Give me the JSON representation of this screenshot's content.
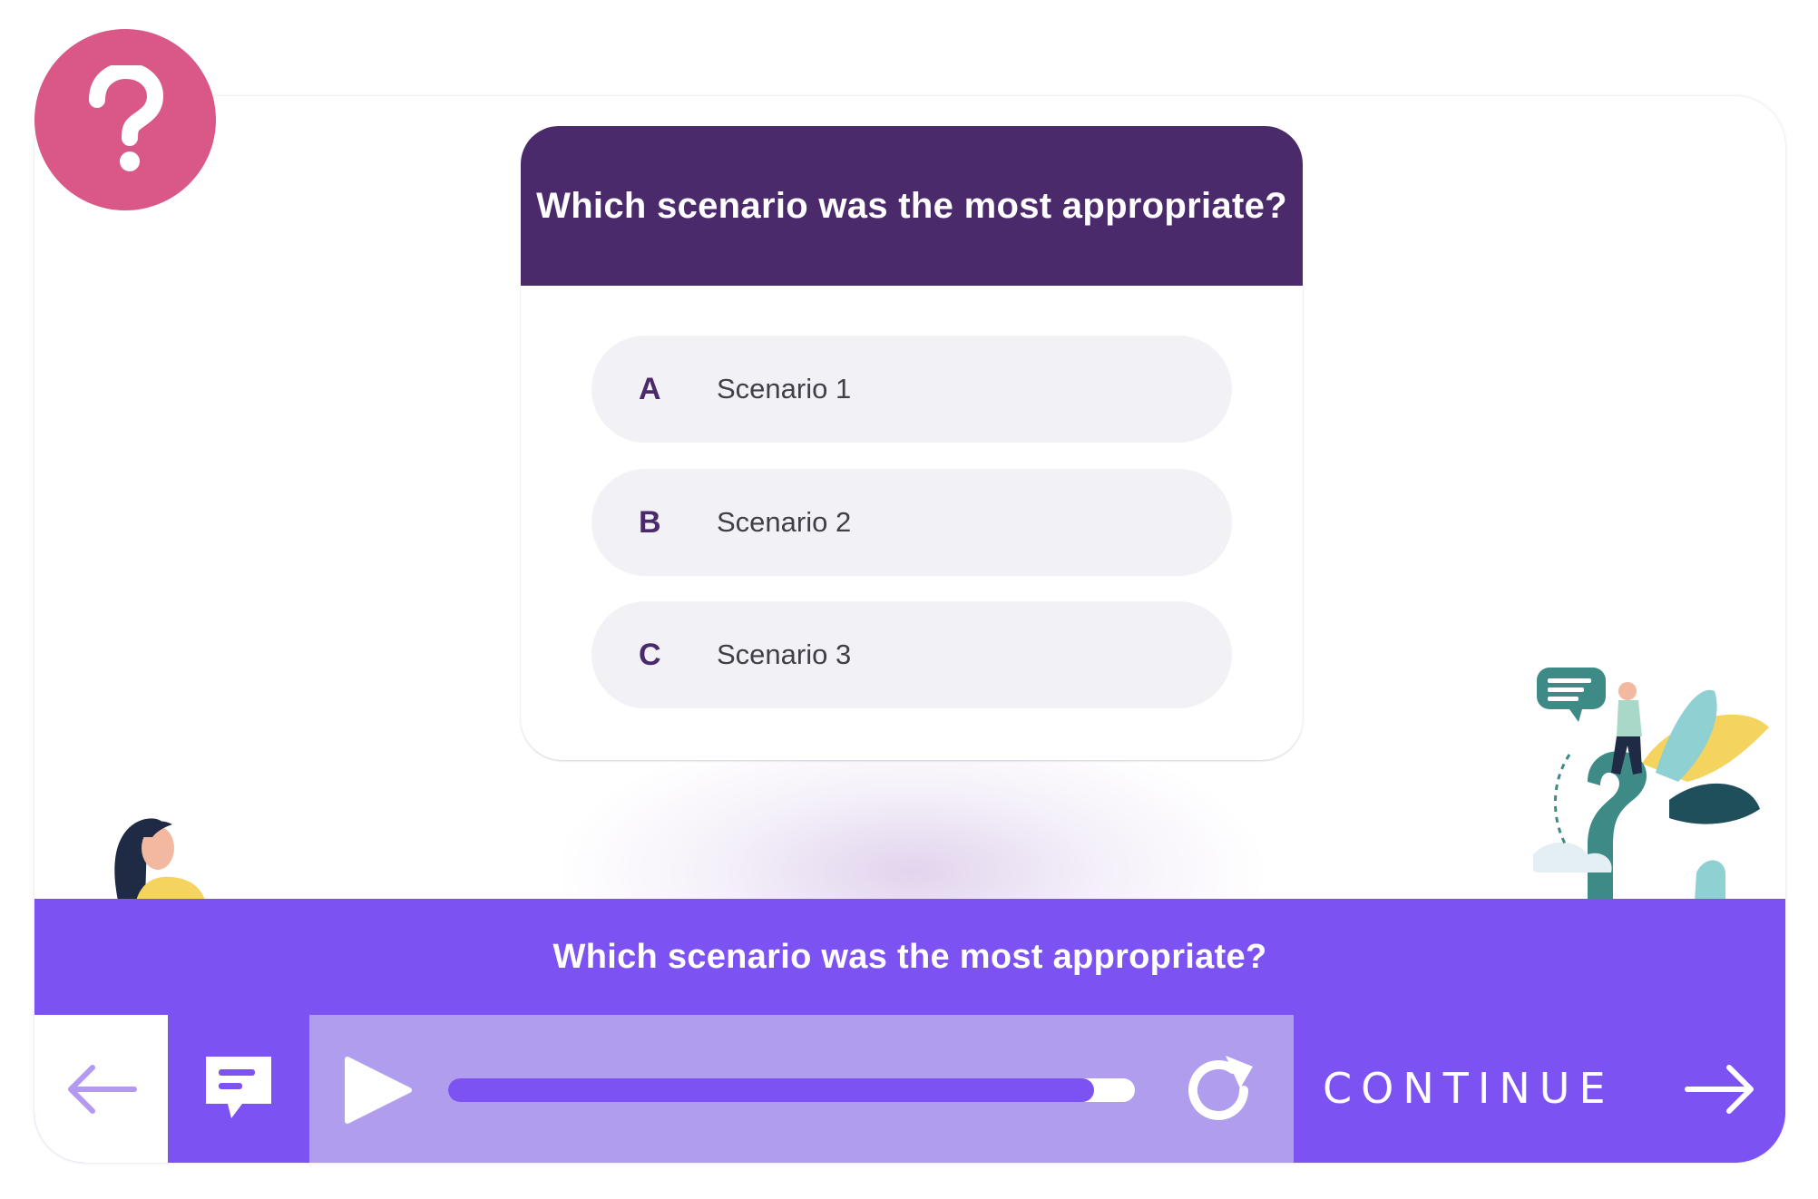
{
  "question": {
    "text": "Which scenario was the most appropriate?"
  },
  "options": [
    {
      "letter": "A",
      "label": "Scenario 1"
    },
    {
      "letter": "B",
      "label": "Scenario 2"
    },
    {
      "letter": "C",
      "label": "Scenario 3"
    }
  ],
  "caption": {
    "text": "Which scenario was the most appropriate?"
  },
  "controls": {
    "continue_label": "CONTINUE",
    "progress_fraction": 0.94,
    "back_icon": "arrow-left-icon",
    "transcript_icon": "transcript-chat-icon",
    "play_icon": "play-icon",
    "replay_icon": "replay-icon",
    "forward_icon": "arrow-right-icon"
  },
  "badge": {
    "icon": "question-mark-icon"
  },
  "colors": {
    "badge": "#d95888",
    "question_box": "#4a2a6b",
    "accent": "#7c52f3",
    "player_bg": "#b19ded",
    "option_bg": "#f2f1f5"
  }
}
